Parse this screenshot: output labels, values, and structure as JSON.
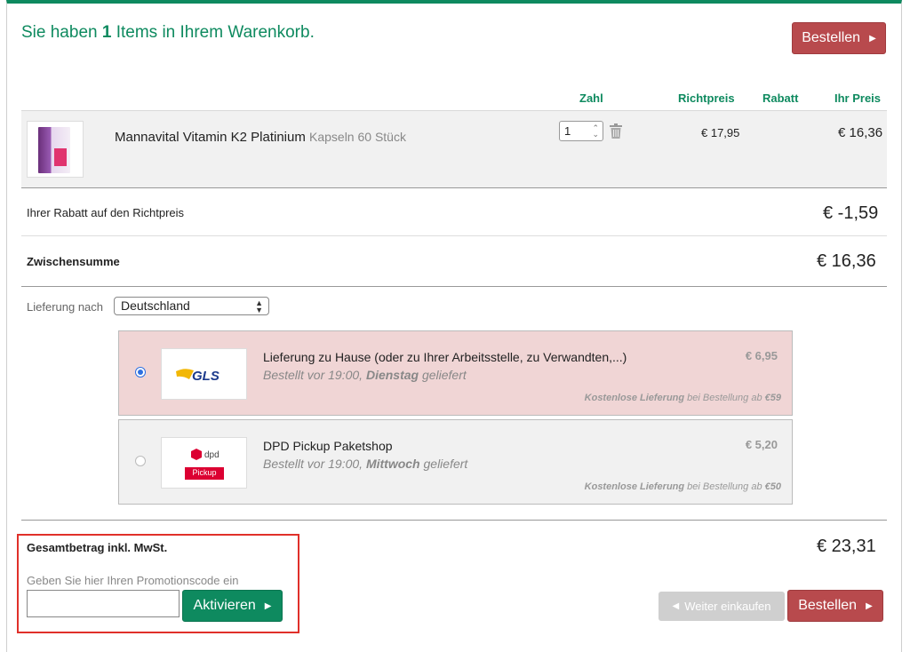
{
  "cart": {
    "title_prefix": "Sie haben ",
    "title_count": "1",
    "title_suffix": " Items in Ihrem Warenkorb."
  },
  "buttons": {
    "order_top": "Bestellen",
    "order_bottom": "Bestellen",
    "continue_shopping": "Weiter einkaufen",
    "activate": "Aktivieren"
  },
  "table": {
    "headers": [
      "Zahl",
      "Richtpreis",
      "Rabatt",
      "Ihr Preis"
    ]
  },
  "product": {
    "name": "Mannavital Vitamin K2 Platinium",
    "variant": "Kapseln 60 Stück",
    "quantity": "1",
    "list_price": "€ 17,95",
    "discount": "",
    "your_price": "€ 16,36"
  },
  "summary": {
    "discount_label": "Ihrer Rabatt auf den Richtpreis",
    "discount_value": "€ -1,59",
    "subtotal_label": "Zwischensumme",
    "subtotal_value": "€ 16,36",
    "total_label": "Gesamtbetrag inkl. MwSt.",
    "total_value": "€ 23,31"
  },
  "delivery": {
    "label": "Lieferung nach",
    "country": "Deutschland",
    "options": [
      {
        "carrier": "GLS",
        "title": "Lieferung zu Hause (oder zu Ihrer Arbeitsstelle, zu Verwandten,...)",
        "sub_prefix": "Bestellt vor 19:00, ",
        "sub_day": "Dienstag",
        "sub_suffix": " geliefert",
        "price": "€ 6,95",
        "free_bold": "Kostenlose Lieferung",
        "free_mid": " bei Bestellung ab ",
        "free_amount": "€59",
        "selected": true
      },
      {
        "carrier": "dpd",
        "carrier_sub": "Pickup",
        "title": "DPD Pickup Paketshop",
        "sub_prefix": "Bestellt vor 19:00, ",
        "sub_day": "Mittwoch",
        "sub_suffix": " geliefert",
        "price": "€ 5,20",
        "free_bold": "Kostenlose Lieferung",
        "free_mid": " bei Bestellung ab ",
        "free_amount": "€50",
        "selected": false
      }
    ]
  },
  "promo": {
    "label": "Geben Sie hier Ihren Promotionscode ein",
    "value": ""
  },
  "colors": {
    "accent_green": "#0e8a5f",
    "order_red": "#b84a4d",
    "selected_row": "#f0d5d5",
    "highlight_frame": "#e0302a"
  }
}
